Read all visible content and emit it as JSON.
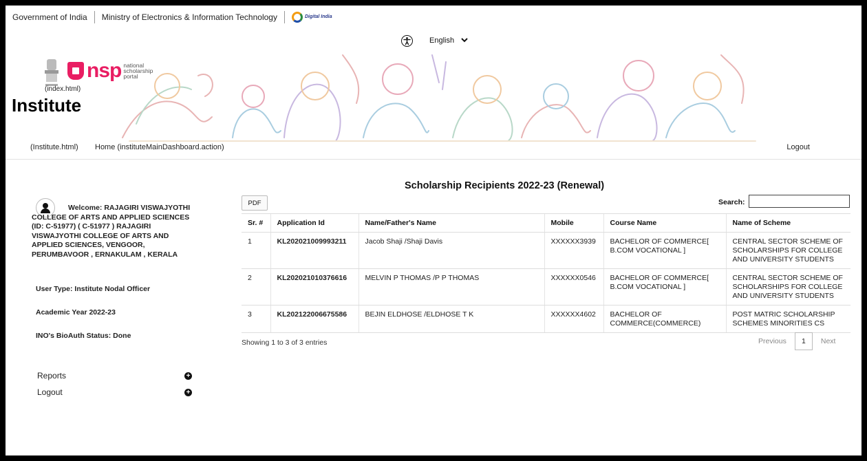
{
  "govbar": {
    "gov": "Government of India",
    "ministry": "Ministry of Electronics & Information Technology",
    "digital_india": "Digital India"
  },
  "header": {
    "language": "English",
    "emblem_caption": "(index.html)",
    "nsp_short": "nsp",
    "nsp_full_line1": "national",
    "nsp_full_line2": "scholarship",
    "nsp_full_line3": "portal",
    "title": "Institute"
  },
  "nav": {
    "institute_link": "(Institute.html)",
    "home_link": "Home (instituteMainDashboard.action)",
    "logout": "Logout"
  },
  "sidebar": {
    "welcome_line1": "Welcome: RAJAGIRI VISWAJYOTHI",
    "welcome_rest": "COLLEGE OF ARTS AND APPLIED SCIENCES (ID: C-51977) ( C-51977 ) RAJAGIRI VISWAJYOTHI COLLEGE OF ARTS AND APPLIED SCIENCES, VENGOOR, PERUMBAVOOR , ERNAKULAM , KERALA",
    "user_type": "User Type:   Institute Nodal Officer",
    "academic_year": "Academic Year    2022-23",
    "bioauth": "INO's BioAuth Status:    Done",
    "menu": [
      {
        "label": "Reports"
      },
      {
        "label": "Logout"
      }
    ]
  },
  "main": {
    "title": "Scholarship Recipients 2022-23 (Renewal)",
    "pdf_label": "PDF",
    "search_label": "Search:",
    "search_value": "",
    "columns": [
      "Sr. #",
      "Application Id",
      "Name/Father's Name",
      "Mobile",
      "Course Name",
      "Name of Scheme"
    ],
    "rows": [
      {
        "sr": "1",
        "app_id": "KL202021009993211",
        "name": "Jacob Shaji /Shaji Davis",
        "mobile": "XXXXXX3939",
        "course": "BACHELOR OF COMMERCE[ B.COM VOCATIONAL ]",
        "scheme": "CENTRAL SECTOR SCHEME OF SCHOLARSHIPS FOR COLLEGE AND UNIVERSITY STUDENTS"
      },
      {
        "sr": "2",
        "app_id": "KL202021010376616",
        "name": "MELVIN P THOMAS /P P THOMAS",
        "mobile": "XXXXXX0546",
        "course": "BACHELOR OF COMMERCE[ B.COM VOCATIONAL ]",
        "scheme": "CENTRAL SECTOR SCHEME OF SCHOLARSHIPS FOR COLLEGE AND UNIVERSITY STUDENTS"
      },
      {
        "sr": "3",
        "app_id": "KL202122006675586",
        "name": "BEJIN ELDHOSE /ELDHOSE T K",
        "mobile": "XXXXXX4602",
        "course": "BACHELOR OF COMMERCE(COMMERCE)",
        "scheme": "POST MATRIC SCHOLARSHIP SCHEMES MINORITIES CS"
      }
    ],
    "showing": "Showing 1 to 3 of 3 entries",
    "pager": {
      "prev": "Previous",
      "page": "1",
      "next": "Next"
    }
  },
  "colors": {
    "nsp_pink": "#e91e63",
    "frame": "#000000"
  }
}
